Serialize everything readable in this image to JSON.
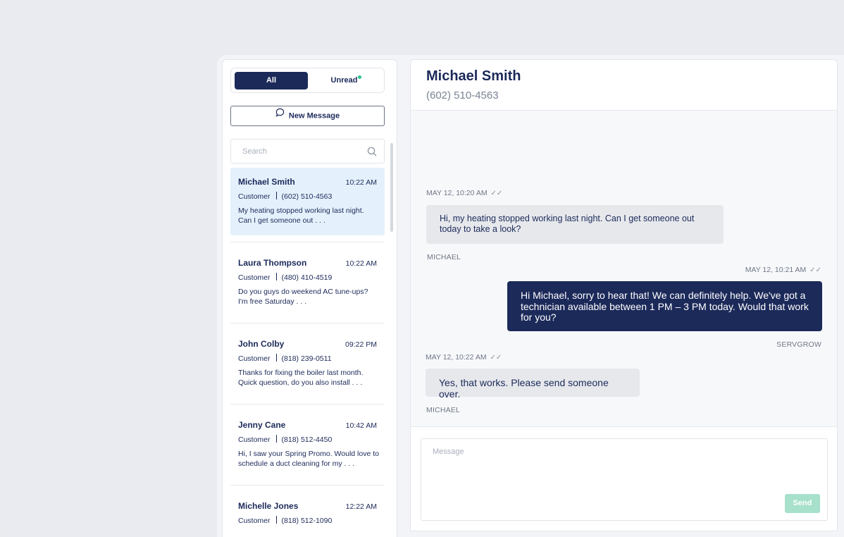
{
  "filters": {
    "all_label": "All",
    "unread_label": "Unread"
  },
  "new_message_label": "New Message",
  "search": {
    "placeholder": "Search"
  },
  "conversations": [
    {
      "name": "Michael Smith",
      "time": "10:22 AM",
      "type": "Customer",
      "phone": "(602) 510-4563",
      "preview": "My heating stopped working last night. Can I get someone out . . ."
    },
    {
      "name": "Laura Thompson",
      "time": "10:22 AM",
      "type": "Customer",
      "phone": "(480) 410-4519",
      "preview": "Do you guys do weekend AC tune-ups? I'm free Saturday  . . ."
    },
    {
      "name": "John Colby",
      "time": "09:22 PM",
      "type": "Customer",
      "phone": "(818) 239-0511",
      "preview": "Thanks for fixing the boiler last month. Quick question, do you also install . . ."
    },
    {
      "name": "Jenny Cane",
      "time": "10:42 AM",
      "type": "Customer",
      "phone": "(818) 512-4450",
      "preview": "Hi, I saw your Spring Promo. Would love to schedule a duct cleaning for my . . ."
    },
    {
      "name": "Michelle Jones",
      "time": "12:22 AM",
      "type": "Customer",
      "phone": "(818) 512-1090",
      "preview": ""
    }
  ],
  "chat": {
    "contact_name": "Michael Smith",
    "contact_phone": "(602) 510-4563",
    "messages": [
      {
        "timestamp": "MAY 12, 10:20 AM",
        "text": "Hi, my heating stopped working last night. Can I get someone out today to take a look?",
        "sender": "MICHAEL"
      },
      {
        "timestamp": "MAY 12, 10:21 AM",
        "text": "Hi Michael, sorry to hear that! We can definitely help. We've got a technician available between 1 PM – 3 PM today. Would that work for you?",
        "sender": "SERVGROW"
      },
      {
        "timestamp": "MAY 12, 10:22 AM",
        "text": "Yes, that works. Please send someone over.",
        "sender": "MICHAEL"
      }
    ],
    "composer_placeholder": "Message",
    "send_label": "Send"
  },
  "colors": {
    "primary": "#1c2a5a",
    "active_row": "#e4f1fc",
    "unread_dot": "#2bc38d",
    "send_disabled": "#a7e0cb"
  }
}
